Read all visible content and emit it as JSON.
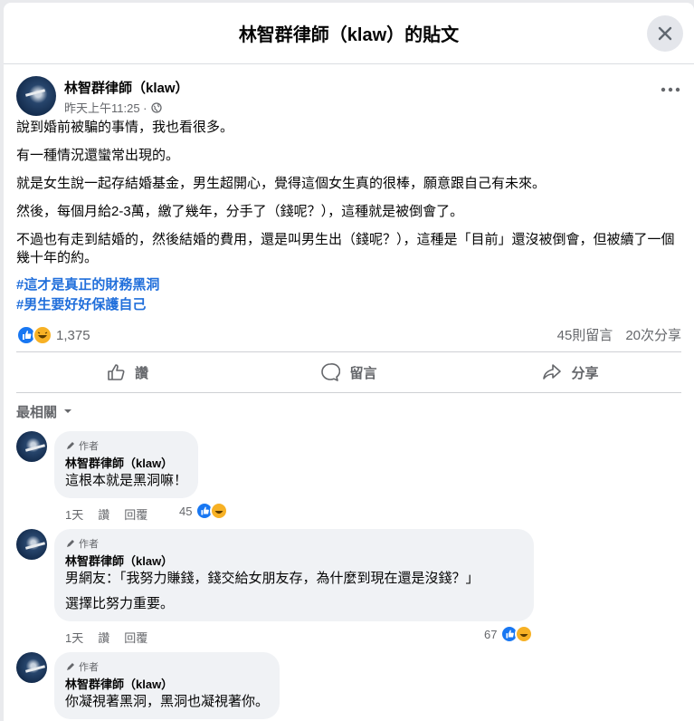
{
  "modal": {
    "title": "林智群律師（klaw）的貼文"
  },
  "post": {
    "author": "林智群律師（klaw）",
    "time": "昨天上午11:25 ·",
    "paragraphs": [
      "說到婚前被騙的事情，我也看很多。",
      "有一種情況還蠻常出現的。",
      "就是女生說一起存結婚基金，男生超開心，覺得這個女生真的很棒，願意跟自己有未來。",
      "然後，每個月給2-3萬，繳了幾年，分手了（錢呢？），這種就是被倒會了。",
      "不過也有走到結婚的，然後結婚的費用，還是叫男生出（錢呢？），這種是「目前」還沒被倒會，但被續了一個幾十年的約。"
    ],
    "hashtags": [
      "#這才是真正的財務黑洞",
      "#男生要好好保護自己"
    ],
    "reaction_count": "1,375",
    "comments_count": "45則留言",
    "shares_count": "20次分享"
  },
  "actions": {
    "like": "讚",
    "comment": "留言",
    "share": "分享"
  },
  "sort": {
    "label": "最相關"
  },
  "comments": [
    {
      "badge": "作者",
      "name": "林智群律師（klaw）",
      "lines": [
        "這根本就是黑洞嘛！"
      ],
      "time": "1天",
      "like": "讚",
      "reply": "回覆",
      "reactions": "45"
    },
    {
      "badge": "作者",
      "name": "林智群律師（klaw）",
      "lines": [
        "男網友：「我努力賺錢，錢交給女朋友存，為什麼到現在還是沒錢？」",
        "選擇比努力重要。"
      ],
      "time": "1天",
      "like": "讚",
      "reply": "回覆",
      "reactions": "67"
    },
    {
      "badge": "作者",
      "name": "林智群律師（klaw）",
      "lines": [
        "你凝視著黑洞，黑洞也凝視著你。"
      ]
    }
  ],
  "colors": {
    "link": "#216fdb",
    "like": "#1877f2",
    "haha": "#f7b125",
    "meta": "#65676b",
    "bubble": "#f0f2f5"
  },
  "icons": {
    "close": "close-icon",
    "globe": "globe-icon",
    "more": "more-icon",
    "like": "thumbs-up-icon",
    "comment": "comment-icon",
    "share": "share-icon",
    "caret": "caret-down-icon",
    "author": "pencil-icon"
  }
}
